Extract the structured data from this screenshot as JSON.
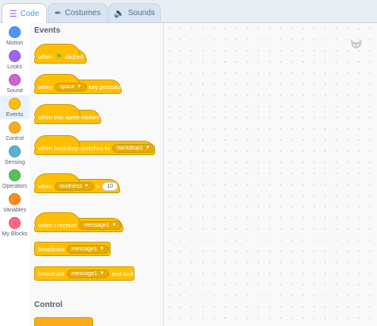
{
  "tabs": [
    {
      "label": "Code",
      "icon": "code-icon",
      "active": true
    },
    {
      "label": "Costumes",
      "icon": "brush-icon",
      "active": false
    },
    {
      "label": "Sounds",
      "icon": "speaker-icon",
      "active": false
    }
  ],
  "categories": [
    {
      "label": "Motion",
      "color": "#4c97ff"
    },
    {
      "label": "Looks",
      "color": "#9966ff"
    },
    {
      "label": "Sound",
      "color": "#cf63cf"
    },
    {
      "label": "Events",
      "color": "#ffbf00",
      "selected": true
    },
    {
      "label": "Control",
      "color": "#ffab19"
    },
    {
      "label": "Sensing",
      "color": "#5cb1d6"
    },
    {
      "label": "Operators",
      "color": "#59c059"
    },
    {
      "label": "Variables",
      "color": "#ff8c1a"
    },
    {
      "label": "My Blocks",
      "color": "#ff6680"
    }
  ],
  "palette": {
    "events_title": "Events",
    "control_title": "Control",
    "when_flag": {
      "pre": "when",
      "post": "clicked"
    },
    "when_key": {
      "pre": "when",
      "key": "space",
      "post": "key pressed"
    },
    "when_sprite": "when this sprite clicked",
    "when_backdrop": {
      "pre": "when backdrop switches to",
      "value": "backdrop1"
    },
    "when_loudness": {
      "pre": "when",
      "sensor": "loudness",
      "op": ">",
      "value": "10"
    },
    "when_receive": {
      "pre": "when I receive",
      "value": "message1"
    },
    "broadcast": {
      "pre": "broadcast",
      "value": "message1"
    },
    "broadcast_wait": {
      "pre": "broadcast",
      "value": "message1",
      "post": "and wait"
    }
  }
}
